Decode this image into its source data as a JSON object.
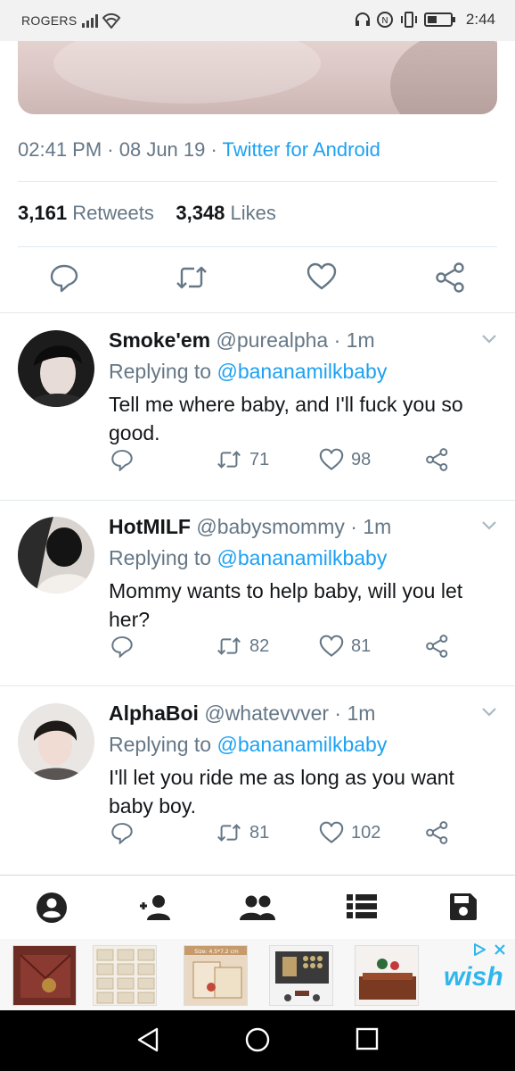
{
  "status_bar": {
    "carrier": "ROGERS",
    "time": "2:44",
    "icons": [
      "signal-icon",
      "wifi-icon",
      "headphones-icon",
      "nfc-icon",
      "vibrate-icon",
      "battery-icon"
    ]
  },
  "tweet": {
    "time": "02:41 PM",
    "date": "08 Jun 19",
    "source": "Twitter for Android",
    "retweets_count": "3,161",
    "retweets_label": "Retweets",
    "likes_count": "3,348",
    "likes_label": "Likes",
    "actions": [
      "reply-icon",
      "retweet-icon",
      "like-icon",
      "share-icon"
    ]
  },
  "replies": [
    {
      "name": "Smoke'em",
      "handle": "@purealpha",
      "age": "1m",
      "replying_label": "Replying to",
      "replying_to": "@bananamilkbaby",
      "text": "Tell me where baby, and I'll fuck you so good.",
      "retweets": "71",
      "likes": "98"
    },
    {
      "name": "HotMILF",
      "handle": "@babysmommy",
      "age": "1m",
      "replying_label": "Replying to",
      "replying_to": "@bananamilkbaby",
      "text": "Mommy wants to help baby, will you let her?",
      "retweets": "82",
      "likes": "81"
    },
    {
      "name": "AlphaBoi",
      "handle": "@whatevvver",
      "age": "1m",
      "replying_label": "Replying to",
      "replying_to": "@bananamilkbaby",
      "text": "I'll let you ride me as long as you want baby boy.",
      "retweets": "81",
      "likes": "102"
    }
  ],
  "bottom_nav": [
    "profile-icon",
    "follow-icon",
    "people-icon",
    "list-icon",
    "save-icon"
  ],
  "ad": {
    "brand": "wish",
    "thumb_caption": "Size: 4.5*7.2 cm"
  },
  "colors": {
    "accent": "#1da1f2",
    "secondary_text": "#657786",
    "divider": "#e1e8ed",
    "icon": "#657786",
    "nav_icon": "#222222",
    "wish": "#2fb7ec"
  }
}
